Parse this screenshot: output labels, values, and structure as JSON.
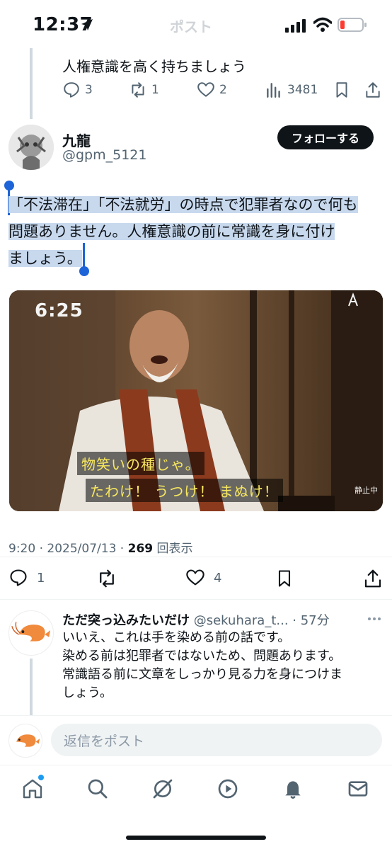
{
  "status_bar": {
    "time": "12:37",
    "faded_title": "ポスト"
  },
  "prev_post": {
    "text": "人権意識を高く持ちましょう",
    "replies": "3",
    "reposts": "1",
    "likes": "2",
    "views": "3481"
  },
  "main_post": {
    "display_name": "九龍",
    "handle": "@gpm_5121",
    "follow_label": "フォローする",
    "text_line1": "「不法滞在」「不法就労」の時点で犯罪者なので何も",
    "text_line2": "問題ありません。人権意識の前に常識を身に付け",
    "text_line3": "ましょう。",
    "media": {
      "clock": "6:25",
      "subtitle1": "物笑いの種じゃ。",
      "subtitle2": "たわけ！ うつけ！ まぬけ！",
      "paused_label": "静止中"
    },
    "time": "9:20",
    "date": "2025/07/13",
    "views": "269",
    "views_label": "回表示",
    "replies": "1",
    "likes": "4"
  },
  "reply": {
    "display_name": "ただ突っ込みたいだけ",
    "handle": "@sekuhara_t...",
    "age": "57分",
    "line1": "いいえ、これは手を染める前の話です。",
    "line2": "染める前は犯罪者ではないため、問題あります。",
    "line3": "常識語る前に文章をしっかり見る力を身につけま",
    "line4": "しょう。"
  },
  "composer": {
    "placeholder": "返信をポスト"
  },
  "tabs": [
    "home-icon",
    "search-icon",
    "grok-icon",
    "video-icon",
    "notifications-icon",
    "messages-icon"
  ],
  "colors": {
    "selection": "#c8d9ee",
    "handle": "#1d64d8",
    "muted": "#536471"
  }
}
